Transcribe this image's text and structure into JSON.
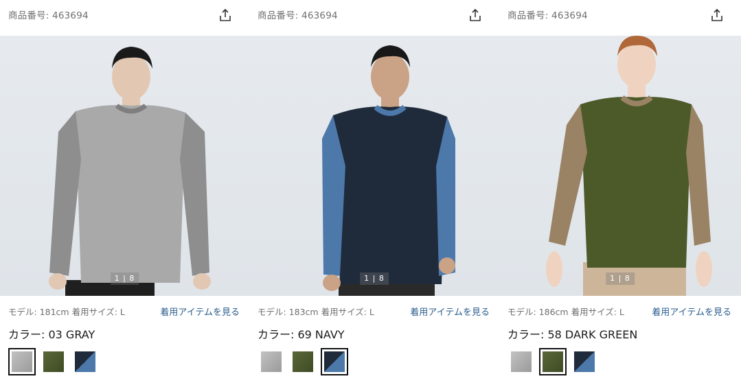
{
  "panels": [
    {
      "product_id": "商品番号: 463694",
      "image_counter": "1 | 8",
      "model": "モデル: 181cm 着用サイズ: L",
      "view_link": "着用アイテムを見る",
      "color_label": "カラー: 03 GRAY",
      "selected_swatch": 0,
      "shirt": {
        "body": "#a9a9a9",
        "sleeve": "#8e8e8e",
        "collar": "#7f7f7f",
        "pants": "#1f1f1f",
        "hair": "#1a1a1a",
        "skin": "#e2c8b2"
      }
    },
    {
      "product_id": "商品番号: 463694",
      "image_counter": "1 | 8",
      "model": "モデル: 183cm 着用サイズ: L",
      "view_link": "着用アイテムを見る",
      "color_label": "カラー: 69 NAVY",
      "selected_swatch": 2,
      "shirt": {
        "body": "#1f2a3a",
        "sleeve": "#4c78aa",
        "collar": "#4c78aa",
        "pants": "#2a2a2a",
        "hair": "#181818",
        "skin": "#caa286"
      }
    },
    {
      "product_id": "商品番号: 463694",
      "image_counter": "1 | 8",
      "model": "モデル: 186cm 着用サイズ: L",
      "view_link": "着用アイテムを見る",
      "color_label": "カラー: 58 DARK GREEN",
      "selected_swatch": 1,
      "shirt": {
        "body": "#4c5a2a",
        "sleeve": "#9a8264",
        "collar": "#9a8264",
        "pants": "#cdb59a",
        "hair": "#b0683a",
        "skin": "#efd3c0"
      }
    }
  ],
  "swatch_colors": [
    [
      "#b8b8b8",
      "#9a9a9a"
    ],
    [
      "#46532a",
      "#5a6838"
    ],
    [
      "#1f2a3a",
      "#4c78aa"
    ]
  ],
  "icons": {
    "share": "share-icon"
  }
}
